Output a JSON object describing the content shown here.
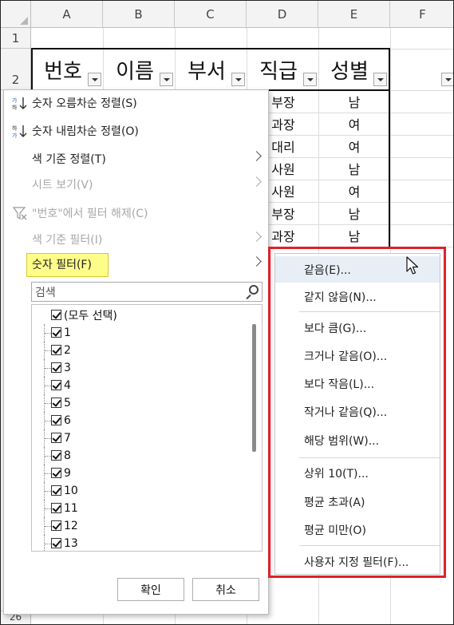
{
  "sheet": {
    "columns": [
      "A",
      "B",
      "C",
      "D",
      "E",
      "F"
    ],
    "rows": [
      "1",
      "2",
      "26"
    ],
    "headers": [
      "번호",
      "이름",
      "부서",
      "직급",
      "성별"
    ],
    "grade": [
      "부장",
      "과장",
      "대리",
      "사원",
      "사원",
      "부장",
      "과장"
    ],
    "gender": [
      "남",
      "여",
      "여",
      "남",
      "여",
      "남",
      "남"
    ]
  },
  "menu": {
    "sort_asc": "숫자 오름차순 정렬(S)",
    "sort_desc": "숫자 내림차순 정렬(O)",
    "sort_color": "색 기준 정렬(T)",
    "sheet_view": "시트 보기(V)",
    "clear_filter": "\"번호\"에서 필터 해제(C)",
    "filter_color": "색 기준 필터(I)",
    "number_filter": "숫자 필터(F)",
    "search_placeholder": "검색",
    "items": [
      "(모두 선택)",
      "1",
      "2",
      "3",
      "4",
      "5",
      "6",
      "7",
      "8",
      "9",
      "10",
      "11",
      "12",
      "13"
    ],
    "ok": "확인",
    "cancel": "취소"
  },
  "submenu": {
    "items": [
      "같음(E)...",
      "같지 않음(N)...",
      "보다 큼(G)...",
      "크거나 같음(O)...",
      "보다 작음(L)...",
      "작거나 같음(Q)...",
      "해당 범위(W)...",
      "상위 10(T)...",
      "평균 초과(A)",
      "평균 미만(O)",
      "사용자 지정 필터(F)..."
    ]
  },
  "colors": {
    "highlight": "#fffd8a",
    "annotation": "#e0202a",
    "hover": "#e7eef6"
  }
}
